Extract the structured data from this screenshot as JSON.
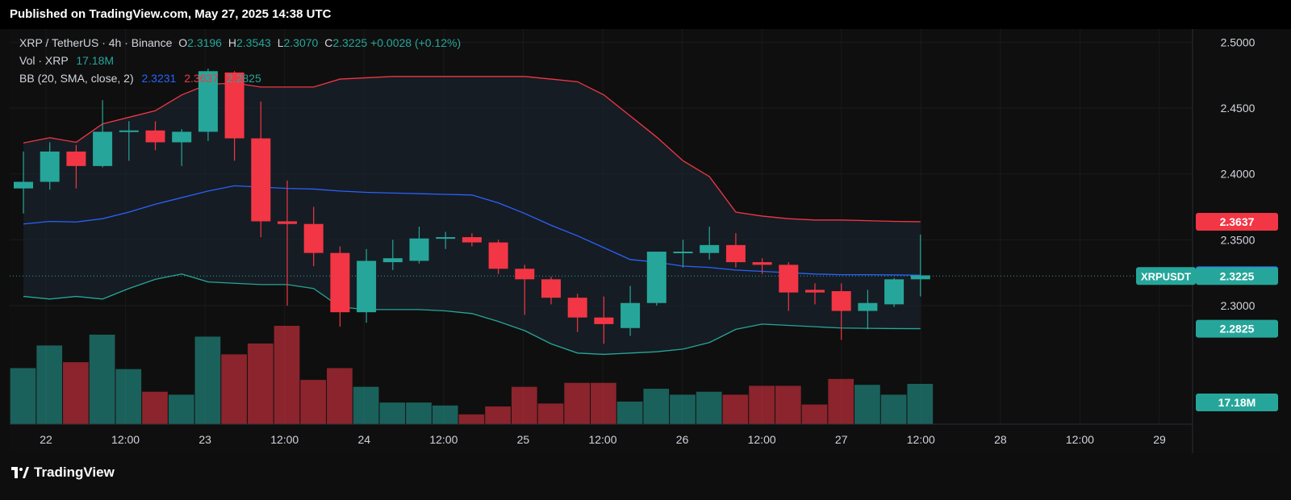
{
  "header": {
    "published": "Published on TradingView.com, May 27, 2025 14:38 UTC"
  },
  "legend": {
    "symbol": "XRP / TetherUS · 4h · Binance",
    "ohlc": {
      "o_label": "O",
      "o": "2.3196",
      "h_label": "H",
      "h": "2.3543",
      "l_label": "L",
      "l": "2.3070",
      "c_label": "C",
      "c": "2.3225",
      "change": "+0.0028 (+0.12%)"
    },
    "vol_label": "Vol · XRP",
    "vol": "17.18M",
    "bb_label": "BB (20, SMA, close, 2)",
    "bb_basis": "2.3231",
    "bb_upper": "2.3637",
    "bb_lower": "2.2825"
  },
  "footer": {
    "brand": "TradingView"
  },
  "colors": {
    "up": "#26a69a",
    "down": "#f23645",
    "bb_basis": "#2962ff",
    "bb_upper": "#f23645",
    "bb_lower": "#26a69a",
    "bb_fill": "#1a2530"
  },
  "chart_data": {
    "type": "candlestick",
    "symbol": "XRPUSDT",
    "price_axis": {
      "min": 2.21,
      "max": 2.51,
      "ticks": [
        "2.5000",
        "2.4500",
        "2.4000",
        "2.3500",
        "2.3000"
      ]
    },
    "time_axis": {
      "ticks": [
        "22",
        "12:00",
        "23",
        "12:00",
        "24",
        "12:00",
        "25",
        "12:00",
        "26",
        "12:00",
        "27",
        "12:00",
        "28",
        "12:00",
        "29"
      ]
    },
    "price_labels": [
      {
        "text": "2.3637",
        "value": 2.3637,
        "color": "#f23645"
      },
      {
        "text": "2.3231",
        "value": 2.3231,
        "color": "#2962ff"
      },
      {
        "text": "XRPUSDT",
        "value": 2.3225,
        "color": "#26a69a",
        "symbol_tag": true
      },
      {
        "text": "2.3225",
        "value": 2.3225,
        "color": "#26a69a"
      },
      {
        "text": "2.2825",
        "value": 2.2825,
        "color": "#26a69a"
      },
      {
        "text": "17.18M",
        "value": 2.2265,
        "color": "#26a69a"
      }
    ],
    "candles": [
      {
        "o": 2.389,
        "h": 2.417,
        "l": 2.37,
        "c": 2.394
      },
      {
        "o": 2.394,
        "h": 2.424,
        "l": 2.388,
        "c": 2.417
      },
      {
        "o": 2.417,
        "h": 2.422,
        "l": 2.389,
        "c": 2.406
      },
      {
        "o": 2.406,
        "h": 2.456,
        "l": 2.405,
        "c": 2.432
      },
      {
        "o": 2.432,
        "h": 2.44,
        "l": 2.41,
        "c": 2.433
      },
      {
        "o": 2.433,
        "h": 2.44,
        "l": 2.418,
        "c": 2.424
      },
      {
        "o": 2.424,
        "h": 2.434,
        "l": 2.406,
        "c": 2.432
      },
      {
        "o": 2.432,
        "h": 2.48,
        "l": 2.425,
        "c": 2.478
      },
      {
        "o": 2.477,
        "h": 2.478,
        "l": 2.41,
        "c": 2.427
      },
      {
        "o": 2.427,
        "h": 2.455,
        "l": 2.352,
        "c": 2.364
      },
      {
        "o": 2.364,
        "h": 2.395,
        "l": 2.3,
        "c": 2.362
      },
      {
        "o": 2.362,
        "h": 2.375,
        "l": 2.33,
        "c": 2.34
      },
      {
        "o": 2.34,
        "h": 2.345,
        "l": 2.284,
        "c": 2.295
      },
      {
        "o": 2.295,
        "h": 2.343,
        "l": 2.287,
        "c": 2.334
      },
      {
        "o": 2.333,
        "h": 2.35,
        "l": 2.327,
        "c": 2.336
      },
      {
        "o": 2.334,
        "h": 2.36,
        "l": 2.332,
        "c": 2.351
      },
      {
        "o": 2.351,
        "h": 2.356,
        "l": 2.343,
        "c": 2.352
      },
      {
        "o": 2.352,
        "h": 2.355,
        "l": 2.345,
        "c": 2.348
      },
      {
        "o": 2.348,
        "h": 2.35,
        "l": 2.324,
        "c": 2.328
      },
      {
        "o": 2.328,
        "h": 2.331,
        "l": 2.293,
        "c": 2.32
      },
      {
        "o": 2.32,
        "h": 2.322,
        "l": 2.301,
        "c": 2.306
      },
      {
        "o": 2.306,
        "h": 2.309,
        "l": 2.28,
        "c": 2.291
      },
      {
        "o": 2.291,
        "h": 2.307,
        "l": 2.271,
        "c": 2.286
      },
      {
        "o": 2.283,
        "h": 2.315,
        "l": 2.277,
        "c": 2.302
      },
      {
        "o": 2.302,
        "h": 2.34,
        "l": 2.3,
        "c": 2.341
      },
      {
        "o": 2.34,
        "h": 2.35,
        "l": 2.329,
        "c": 2.341
      },
      {
        "o": 2.34,
        "h": 2.36,
        "l": 2.335,
        "c": 2.346
      },
      {
        "o": 2.346,
        "h": 2.355,
        "l": 2.329,
        "c": 2.333
      },
      {
        "o": 2.333,
        "h": 2.336,
        "l": 2.324,
        "c": 2.331
      },
      {
        "o": 2.331,
        "h": 2.333,
        "l": 2.296,
        "c": 2.31
      },
      {
        "o": 2.312,
        "h": 2.317,
        "l": 2.301,
        "c": 2.31
      },
      {
        "o": 2.311,
        "h": 2.317,
        "l": 2.274,
        "c": 2.296
      },
      {
        "o": 2.296,
        "h": 2.312,
        "l": 2.282,
        "c": 2.302
      },
      {
        "o": 2.301,
        "h": 2.321,
        "l": 2.299,
        "c": 2.32
      },
      {
        "o": 2.32,
        "h": 2.354,
        "l": 2.307,
        "c": 2.323
      }
    ],
    "volume": [
      0.57,
      0.8,
      0.63,
      0.91,
      0.56,
      0.33,
      0.3,
      0.89,
      0.71,
      0.82,
      1.0,
      0.45,
      0.57,
      0.38,
      0.22,
      0.22,
      0.19,
      0.1,
      0.18,
      0.38,
      0.21,
      0.42,
      0.42,
      0.23,
      0.36,
      0.3,
      0.33,
      0.3,
      0.39,
      0.39,
      0.2,
      0.46,
      0.4,
      0.3,
      0.41
    ],
    "bb_upper": [
      2.4235,
      2.4275,
      2.424,
      2.438,
      2.443,
      2.448,
      2.46,
      2.468,
      2.469,
      2.466,
      2.466,
      2.466,
      2.472,
      2.473,
      2.474,
      2.474,
      2.474,
      2.474,
      2.474,
      2.474,
      2.472,
      2.47,
      2.46,
      2.444,
      2.428,
      2.41,
      2.398,
      2.371,
      2.368,
      2.366,
      2.365,
      2.365,
      2.3645,
      2.364,
      2.3637
    ],
    "bb_basis": [
      2.362,
      2.364,
      2.3635,
      2.366,
      2.371,
      2.377,
      2.382,
      2.387,
      2.391,
      2.39,
      2.389,
      2.3885,
      2.387,
      2.386,
      2.3855,
      2.385,
      2.3845,
      2.384,
      2.378,
      2.37,
      2.361,
      2.353,
      2.344,
      2.335,
      2.333,
      2.33,
      2.329,
      2.327,
      2.326,
      2.325,
      2.324,
      2.3235,
      2.3235,
      2.3233,
      2.3231
    ],
    "bb_lower": [
      2.307,
      2.305,
      2.307,
      2.305,
      2.313,
      2.32,
      2.324,
      2.318,
      2.317,
      2.316,
      2.316,
      2.313,
      2.299,
      2.297,
      2.297,
      2.297,
      2.296,
      2.294,
      2.288,
      2.281,
      2.271,
      2.264,
      2.263,
      2.264,
      2.265,
      2.267,
      2.272,
      2.282,
      2.286,
      2.285,
      2.284,
      2.283,
      2.2828,
      2.2826,
      2.2825
    ],
    "current_price": 2.3225
  }
}
